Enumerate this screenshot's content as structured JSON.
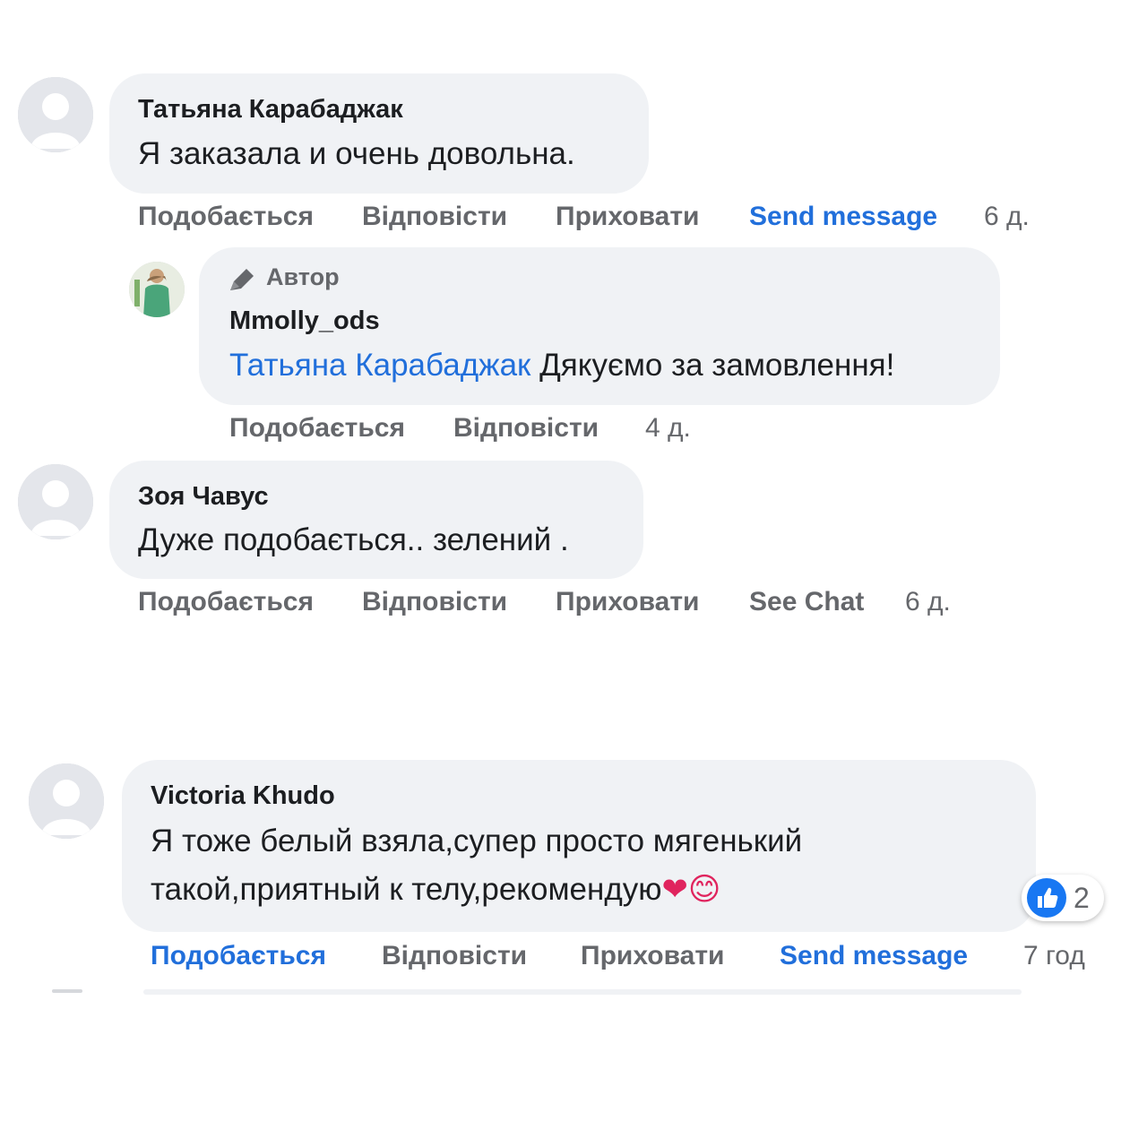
{
  "comments": [
    {
      "author": "Татьяна Карабаджак",
      "text": "Я заказала и очень довольна.",
      "actions": [
        "Подобається",
        "Відповісти",
        "Приховати",
        "Send message"
      ],
      "time": "6 д.",
      "reply": {
        "badge": "Автор",
        "author": "Mmolly_ods",
        "mention": "Татьяна Карабаджак",
        "text": "Дякуємо за замовлення!",
        "actions": [
          "Подобається",
          "Відповісти"
        ],
        "time": "4 д."
      }
    },
    {
      "author": "Зоя Чавус",
      "text": "Дуже подобається.. зелений .",
      "actions": [
        "Подобається",
        "Відповісти",
        "Приховати",
        "See Chat"
      ],
      "time": "6 д."
    },
    {
      "author": "Victoria Khudo",
      "text_line1": "Я тоже белый взяла,супер просто мягенький",
      "text_line2": "такой,приятный к телу,рекомендую",
      "emoji": "❤😊",
      "reactions": {
        "icon": "like-icon",
        "count": "2"
      },
      "actions": [
        "Подобається",
        "Відповісти",
        "Приховати",
        "Send message"
      ],
      "time": "7 год"
    }
  ],
  "colors": {
    "bubble": "#f0f2f5",
    "link": "#216fdb",
    "muted": "#65676b",
    "like": "#1877f2"
  }
}
